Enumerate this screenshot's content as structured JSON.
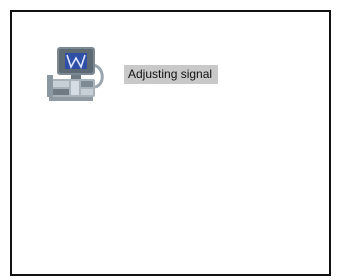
{
  "status": {
    "icon": "scanner-device-icon",
    "label": "Adjusting signal"
  },
  "colors": {
    "frame_border": "#111111",
    "label_background": "#c9c9c9",
    "screen_blue": "#2f4fa6"
  }
}
